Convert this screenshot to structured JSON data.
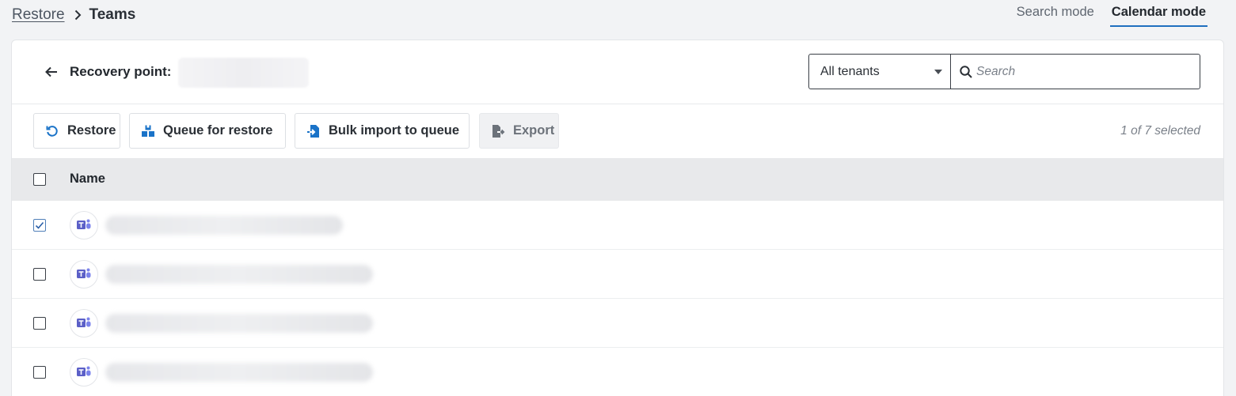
{
  "breadcrumb": {
    "parent": "Restore",
    "current": "Teams"
  },
  "mode_tabs": [
    {
      "label": "Search mode",
      "active": false
    },
    {
      "label": "Calendar mode",
      "active": true
    }
  ],
  "header": {
    "recovery_point_label": "Recovery point:",
    "recovery_point_value": "",
    "tenant_select": "All tenants",
    "search_placeholder": "Search"
  },
  "toolbar": {
    "restore": "Restore",
    "queue_for_restore": "Queue for restore",
    "bulk_import": "Bulk import to queue",
    "export": "Export",
    "selected_count": "1 of 7 selected"
  },
  "table": {
    "columns": [
      "Name"
    ],
    "rows": [
      {
        "checked": true,
        "name": ""
      },
      {
        "checked": false,
        "name": ""
      },
      {
        "checked": false,
        "name": ""
      },
      {
        "checked": false,
        "name": ""
      }
    ]
  },
  "colors": {
    "accent": "#1f6fbf",
    "teams_purple": "#5b5fc7",
    "icon_blue": "#1a73c8"
  },
  "icons": [
    "chevron-right-icon",
    "back-arrow-icon",
    "search-icon",
    "restore-icon",
    "queue-icon",
    "bulk-import-icon",
    "export-icon",
    "checkmark-icon",
    "teams-icon"
  ]
}
